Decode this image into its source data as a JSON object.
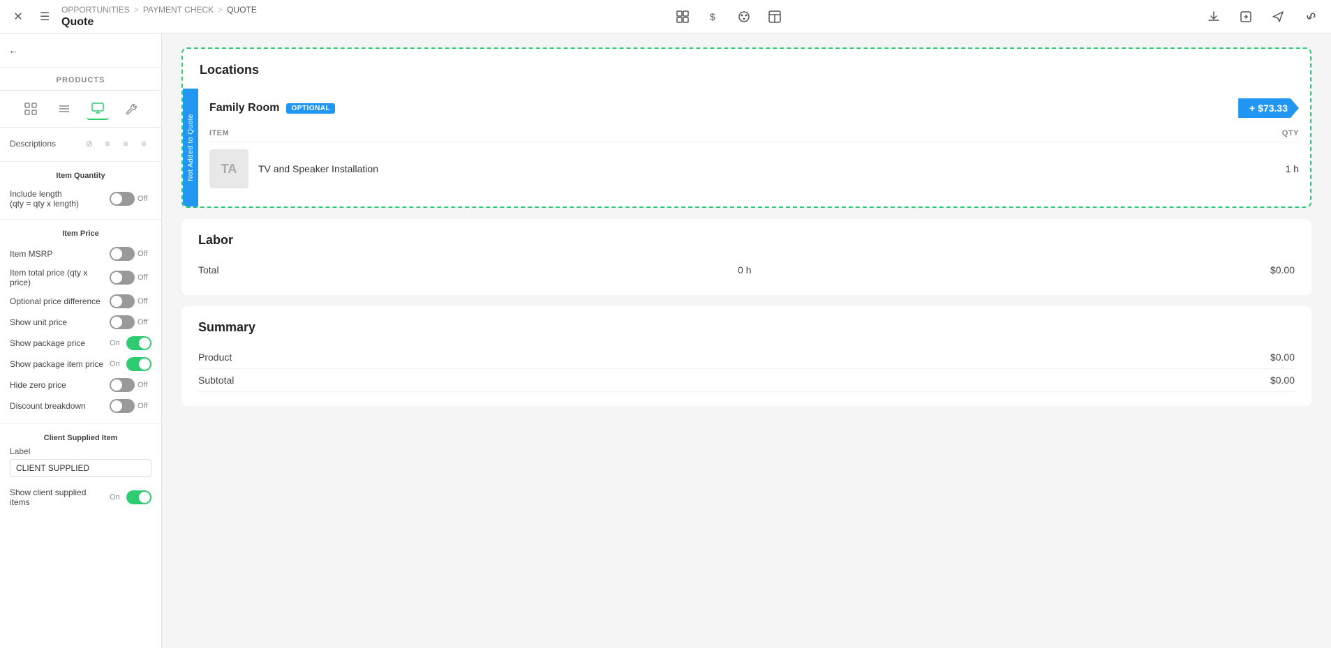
{
  "topbar": {
    "close_label": "✕",
    "menu_label": "☰",
    "breadcrumb": {
      "item1": "OPPORTUNITIES",
      "sep1": ">",
      "item2": "PAYMENT CHECK",
      "sep2": ">",
      "item3": "QUOTE"
    },
    "title": "Quote",
    "icons": {
      "grid": "⊞",
      "dollar": "$",
      "palette": "◎",
      "layout": "▣"
    },
    "right_icons": {
      "download": "⬇",
      "share1": "↗",
      "send": "✈",
      "link": "🔗"
    }
  },
  "sidebar": {
    "header": "PRODUCTS",
    "tabs": [
      {
        "id": "grid",
        "icon": "⊞"
      },
      {
        "id": "list",
        "icon": "☰"
      },
      {
        "id": "monitor",
        "icon": "▣"
      },
      {
        "id": "wrench",
        "icon": "🔧"
      }
    ],
    "descriptions_label": "Descriptions",
    "desc_icons": [
      "⊘",
      "≡",
      "≡",
      "≡"
    ],
    "item_quantity_title": "Item Quantity",
    "include_length_label": "Include length\n(qty = qty x length)",
    "include_length_toggle": "off",
    "item_price_title": "Item Price",
    "item_msrp_label": "Item MSRP",
    "item_msrp_toggle": "off",
    "item_total_price_label": "Item total price (qty x price)",
    "item_total_price_toggle": "off",
    "optional_price_diff_label": "Optional price difference",
    "optional_price_diff_toggle": "off",
    "show_unit_price_label": "Show unit price",
    "show_unit_price_toggle": "off",
    "show_package_price_label": "Show package price",
    "show_package_price_toggle": "on",
    "show_package_item_price_label": "Show package item price",
    "show_package_item_price_toggle": "on",
    "hide_zero_price_label": "Hide zero price",
    "hide_zero_price_toggle": "off",
    "discount_breakdown_label": "Discount breakdown",
    "discount_breakdown_toggle": "off",
    "client_supplied_title": "Client Supplied Item",
    "label_text": "Label",
    "client_supplied_input": "CLIENT SUPPLIED",
    "show_client_supplied_label": "Show client supplied items",
    "show_client_supplied_toggle": "on"
  },
  "main": {
    "locations": {
      "heading": "Locations",
      "sidebar_text": "Not Added to Quote",
      "room_name": "Family Room",
      "room_badge": "OPTIONAL",
      "room_price": "+ $73.33",
      "item_col": "ITEM",
      "qty_col": "QTY",
      "item_thumb": "TA",
      "item_name": "TV and Speaker Installation",
      "item_qty": "1 h"
    },
    "labor": {
      "heading": "Labor",
      "total_label": "Total",
      "total_hours": "0 h",
      "total_price": "$0.00"
    },
    "summary": {
      "heading": "Summary",
      "product_label": "Product",
      "product_value": "$0.00",
      "subtotal_label": "Subtotal",
      "subtotal_value": "$0.00"
    }
  }
}
